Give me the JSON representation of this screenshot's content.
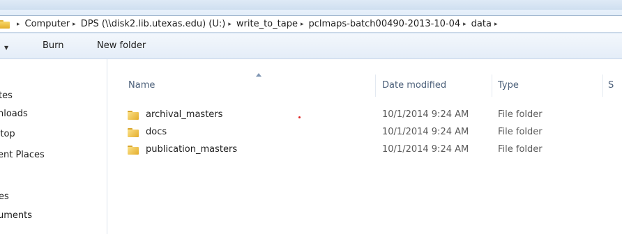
{
  "address": {
    "crumbs": [
      "Computer",
      "DPS (\\\\disk2.lib.utexas.edu) (U:)",
      "write_to_tape",
      "pclmaps-batch00490-2013-10-04",
      "data"
    ],
    "separator": "▸"
  },
  "toolbar": {
    "burn_label": "Burn",
    "new_folder_label": "New folder"
  },
  "nav": {
    "items": [
      {
        "label": "tes"
      },
      {
        "label": "nloads"
      },
      {
        "label": ":top"
      },
      {
        "label": "ent Places"
      },
      {
        "label": "es"
      },
      {
        "label": "uments"
      }
    ]
  },
  "columns": {
    "name": "Name",
    "date": "Date modified",
    "type": "Type",
    "size": "S"
  },
  "files": [
    {
      "name": "archival_masters",
      "date": "10/1/2014 9:24 AM",
      "type": "File folder"
    },
    {
      "name": "docs",
      "date": "10/1/2014 9:24 AM",
      "type": "File folder"
    },
    {
      "name": "publication_masters",
      "date": "10/1/2014 9:24 AM",
      "type": "File folder"
    }
  ],
  "colors": {
    "folder": "#e8b53a",
    "header_text": "#4c607a",
    "accent_red": "#e02020"
  }
}
